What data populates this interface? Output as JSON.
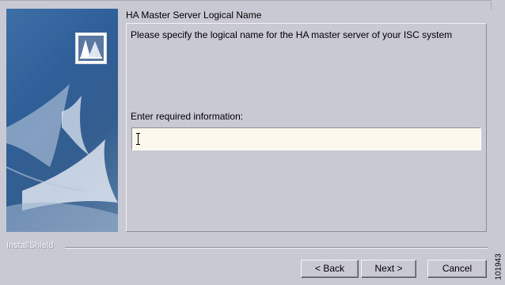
{
  "dialog": {
    "title": "HA Master Server Logical Name",
    "description": "Please specify the logical name for the HA master server of your ISC system",
    "field_label": "Enter required information:",
    "field_value": ""
  },
  "footer": {
    "brand": "InstallShield"
  },
  "buttons": {
    "back": "< Back",
    "next": "Next >",
    "cancel": "Cancel"
  },
  "figure_id": "101943",
  "icons": {
    "side_logo": "installshield-logo-icon",
    "cursor": "text-cursor-icon"
  },
  "colors": {
    "background": "#c9c9d4",
    "side_panel": "#2f5f98",
    "input_background": "#fdf8ee"
  }
}
